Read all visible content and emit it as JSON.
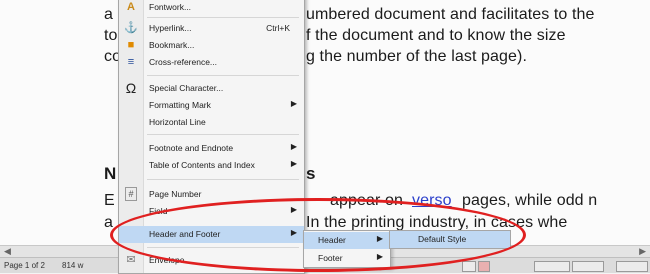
{
  "document": {
    "lines": [
      {
        "left": "a",
        "right": "umbered document and facilitates to the"
      },
      {
        "left": "to",
        "right": "f the document and to know the size"
      },
      {
        "left": "co",
        "right": "g the number of the last page)."
      }
    ],
    "heading_left": "N",
    "heading_right": "s",
    "para2_line1_left": "E",
    "para2_line1_mid": "appear on",
    "para2_line1_link": "verso",
    "para2_line1_right": "pages, while odd n",
    "para2_line2_left": "a",
    "para2_line2_right": "In the printing industry, in cases whe"
  },
  "menu": {
    "items": [
      {
        "label": "Fontwork...",
        "icon": "fontwork-icon"
      },
      {
        "label": "Hyperlink...",
        "shortcut": "Ctrl+K",
        "icon": "hyperlink-icon"
      },
      {
        "label": "Bookmark...",
        "icon": "bookmark-icon"
      },
      {
        "label": "Cross-reference...",
        "icon": "cross-reference-icon"
      },
      {
        "label": "Special Character...",
        "icon": "omega-icon"
      },
      {
        "label": "Formatting Mark"
      },
      {
        "label": "Horizontal Line"
      },
      {
        "label": "Footnote and Endnote"
      },
      {
        "label": "Table of Contents and Index"
      },
      {
        "label": "Page Number",
        "icon": "page-number-icon"
      },
      {
        "label": "Field"
      },
      {
        "label": "Header and Footer"
      },
      {
        "label": "Envelope..."
      }
    ],
    "icons": {
      "hyperlink": "⚓",
      "bookmark": "🔖",
      "omega": "Ω",
      "page": "#",
      "fontwork": "A",
      "xref": "≡"
    }
  },
  "submenu": {
    "header": "Header",
    "footer": "Footer",
    "default_style": "Default Style"
  },
  "statusbar": {
    "page": "Page 1 of 2",
    "words": "814 w",
    "lang": "",
    "zoom": ""
  },
  "colors": {
    "highlight_ellipse": "#e02020",
    "menu_highlight": "#bfd8f3",
    "link": "#2b3fcb"
  }
}
